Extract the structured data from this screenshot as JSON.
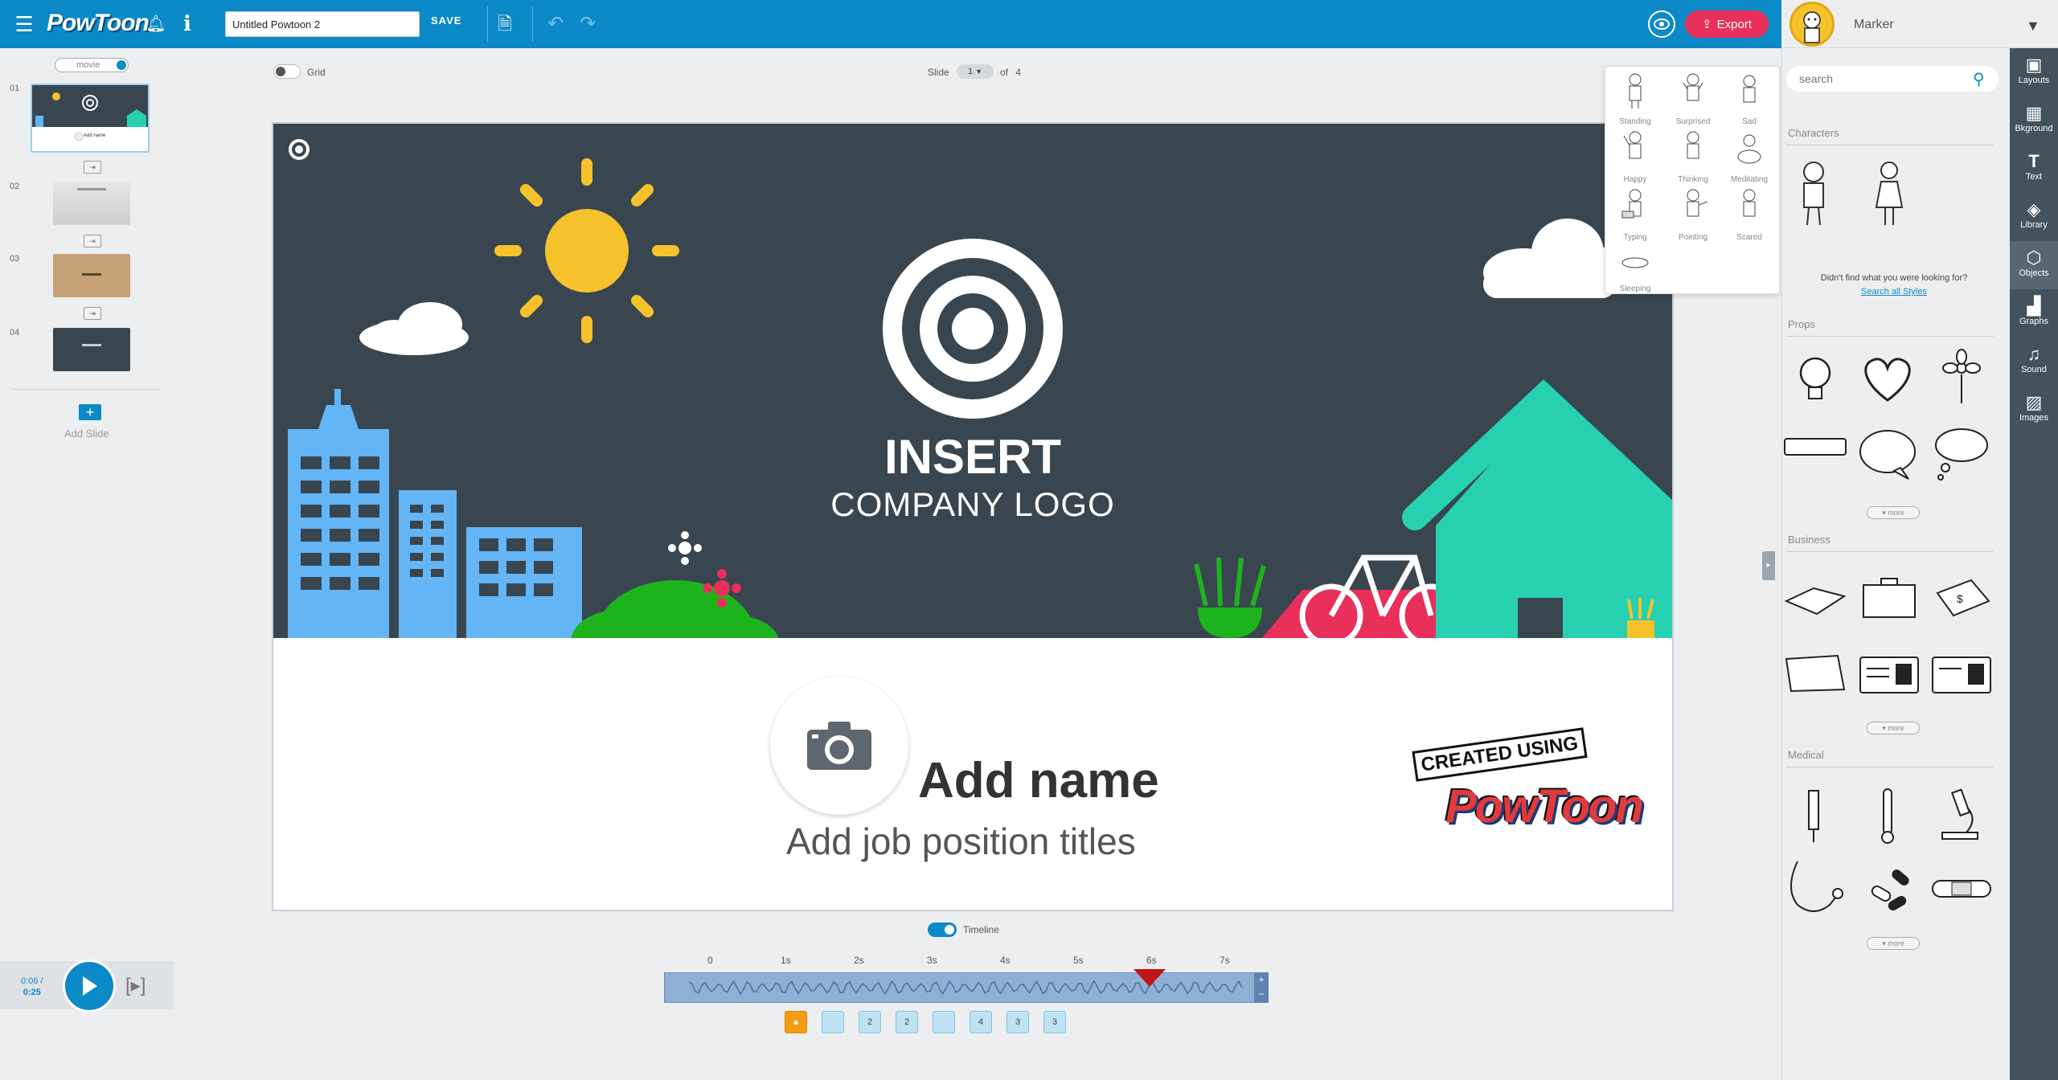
{
  "app": {
    "logo_text": "PowToon",
    "presentation_title": "Untitled Powtoon 2",
    "save_label": "SAVE",
    "export_label": "Export",
    "username": "Marker"
  },
  "slides_panel": {
    "mode_label": "movie",
    "slides": [
      {
        "number": "01",
        "thumb_text": "Add name"
      },
      {
        "number": "02",
        "thumb_text": ""
      },
      {
        "number": "03",
        "thumb_text": ""
      },
      {
        "number": "04",
        "thumb_text": ""
      }
    ],
    "add_slide_label": "Add Slide"
  },
  "toolbar": {
    "grid_label": "Grid",
    "slide_label": "Slide",
    "slide_current": "1",
    "slide_of_label": "of",
    "slide_total": "4"
  },
  "canvas": {
    "insert_text": "INSERT",
    "company_text": "COMPANY LOGO",
    "name_text": "Add name",
    "job_text": "Add job position titles",
    "badge_top": "CREATED USING",
    "badge_logo": "PowToon"
  },
  "pose_popup": {
    "poses": [
      "Standing",
      "Surprised",
      "Sad",
      "Happy",
      "Thinking",
      "Meditating",
      "Typing",
      "Pointing",
      "Scared",
      "Sleeping"
    ]
  },
  "library": {
    "search_placeholder": "search",
    "characters_title": "Characters",
    "not_found_text": "Didn't find what you were looking for?",
    "search_all_link": "Search all Styles",
    "props_title": "Props",
    "business_title": "Business",
    "medical_title": "Medical",
    "more_label": "more"
  },
  "rail": {
    "items": [
      "Layouts",
      "Bkground",
      "Text",
      "Library",
      "Objects",
      "Graphs",
      "Sound",
      "Images"
    ]
  },
  "player": {
    "current_time": "0:06 /",
    "total_time": "0:25"
  },
  "timeline": {
    "label": "Timeline",
    "ticks": [
      "0",
      "1s",
      "2s",
      "3s",
      "4s",
      "5s",
      "6s",
      "7s"
    ],
    "layers": [
      "",
      "",
      "2",
      "2",
      "",
      "4",
      "3",
      "3"
    ]
  },
  "colors": {
    "primary": "#0c89c7",
    "export": "#e8305a",
    "rail": "#43525d",
    "scene_bg": "#394650"
  }
}
